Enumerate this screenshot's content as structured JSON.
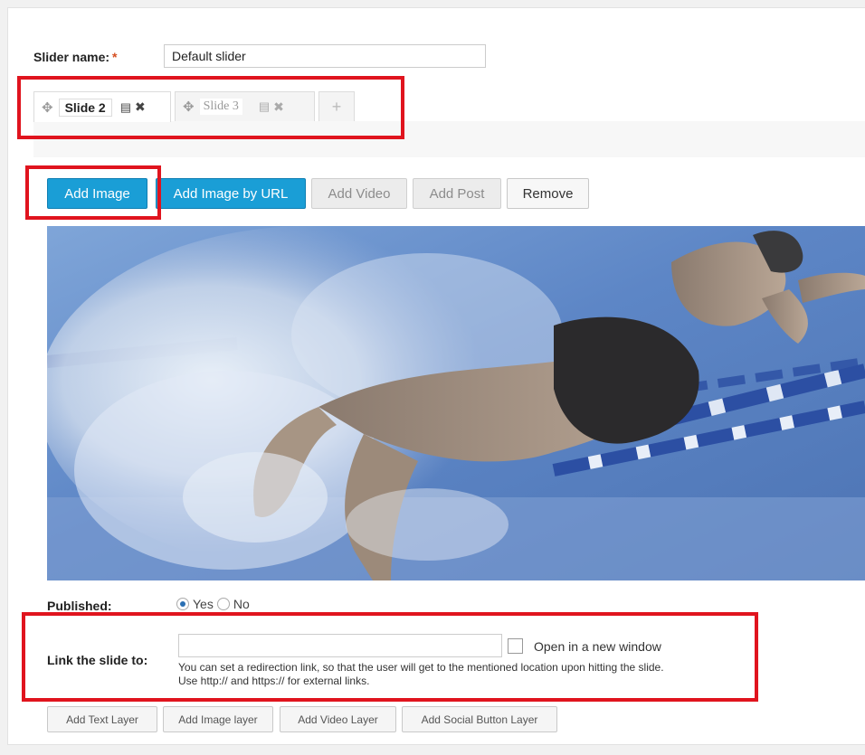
{
  "slider_name": {
    "label": "Slider name:",
    "required_mark": "*",
    "value": "Default slider"
  },
  "tabs": [
    {
      "label": "Slide 2",
      "active": true,
      "move_icon": "move-icon",
      "copy_icon": "copy-icon",
      "close_icon": "close-icon"
    },
    {
      "label": "Slide 3",
      "active": false,
      "move_icon": "move-icon",
      "copy_icon": "copy-icon",
      "close_icon": "close-icon"
    }
  ],
  "add_tab_icon": "+",
  "toolbar": {
    "add_image": "Add Image",
    "add_image_url": "Add Image by URL",
    "add_video": "Add Video",
    "add_post": "Add Post",
    "remove": "Remove"
  },
  "published": {
    "label": "Published:",
    "yes": "Yes",
    "no": "No",
    "selected": "Yes"
  },
  "link": {
    "label": "Link the slide to:",
    "value": "",
    "open_new_window": "Open in a new window",
    "help_line1": "You can set a redirection link, so that the user will get to the mentioned location upon hitting the slide.",
    "help_line2": "Use http:// and https:// for external links."
  },
  "layers": {
    "text": "Add Text Layer",
    "image": "Add Image layer",
    "video": "Add Video Layer",
    "social": "Add Social Button Layer"
  },
  "colors": {
    "primary_button": "#1a9ed6",
    "highlight": "#e0141e",
    "required": "#d54e21"
  }
}
